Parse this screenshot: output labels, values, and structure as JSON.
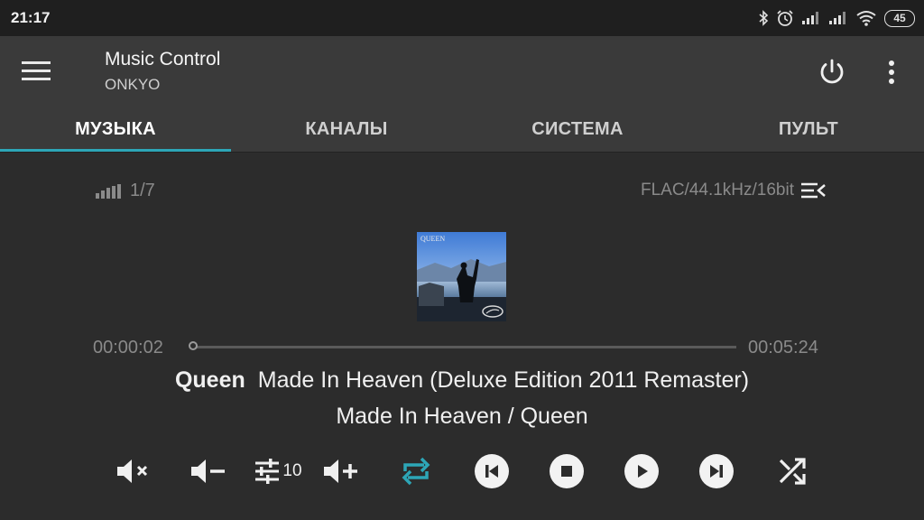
{
  "status_bar": {
    "time": "21:17",
    "battery": "45",
    "icons": [
      "bluetooth-icon",
      "alarm-icon",
      "signal-icon",
      "signal-icon",
      "wifi-icon",
      "battery-icon"
    ]
  },
  "app_bar": {
    "title": "Music Control",
    "subtitle": "ONKYO",
    "icons": [
      "menu-icon",
      "power-icon",
      "more-vert-icon"
    ]
  },
  "tabs": [
    {
      "label": "МУЗЫКА",
      "active": true
    },
    {
      "label": "КАНАЛЫ",
      "active": false
    },
    {
      "label": "СИСТЕМА",
      "active": false
    },
    {
      "label": "ПУЛЬТ",
      "active": false
    }
  ],
  "player": {
    "track_position": "1/7",
    "format": "FLAC/44.1kHz/16bit",
    "current_time": "00:00:02",
    "total_time": "00:05:24",
    "progress": 0.006,
    "artist": "Queen",
    "title": "Made In Heaven (Deluxe Edition 2011 Remaster)",
    "album_line": "Made In Heaven / Queen",
    "cover_text": "QUEEN"
  },
  "controls": {
    "eq_value": "10",
    "icons": [
      "mute-icon",
      "volume-down-icon",
      "equalizer-icon",
      "volume-up-icon",
      "repeat-icon",
      "previous-icon",
      "stop-icon",
      "play-icon",
      "next-icon",
      "shuffle-icon"
    ]
  },
  "colors": {
    "accent": "#2da6b7",
    "background": "#2c2c2c",
    "app_bar": "#3a3a3a"
  }
}
